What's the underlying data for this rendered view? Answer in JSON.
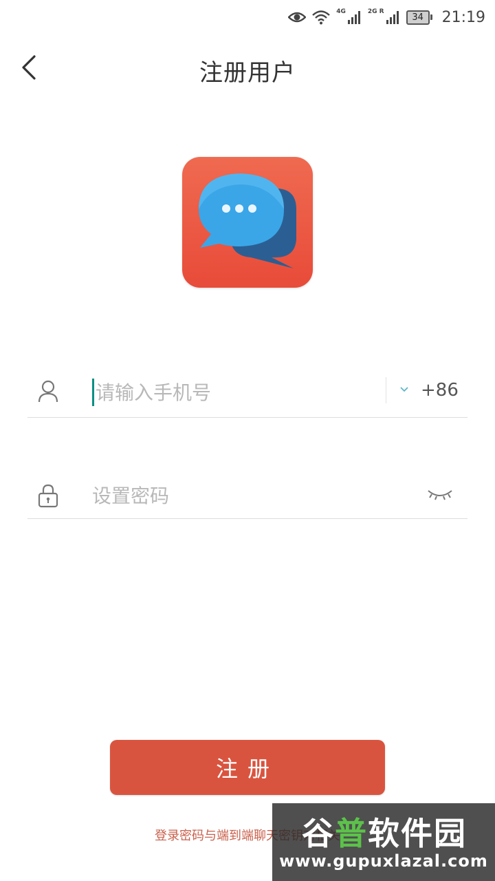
{
  "status_bar": {
    "time": "21:19",
    "battery": "34",
    "net_tag_1": "4G",
    "net_tag_2": "2G R",
    "icons": [
      "eye-icon",
      "wifi-icon",
      "signal-icon",
      "signal-icon",
      "battery-icon"
    ]
  },
  "header": {
    "title": "注册用户",
    "back_icon": "chevron-left-icon"
  },
  "logo": {
    "icon": "chat-bubbles-icon",
    "colors": {
      "background": "#e84b39",
      "bubble_front": "#3aa6e8",
      "bubble_back": "#2b5f93"
    }
  },
  "form": {
    "phone": {
      "placeholder": "请输入手机号",
      "value": "",
      "country_code": "+86",
      "icon": "user-icon",
      "dropdown_icon": "chevron-down-icon"
    },
    "password": {
      "placeholder": "设置密码",
      "value": "",
      "icon": "lock-icon",
      "toggle_icon": "eye-closed-icon"
    }
  },
  "register_button": {
    "label": "注册"
  },
  "notice": "登录密码与端到端聊天密钥对相关",
  "watermark": {
    "title_white_1": "谷",
    "title_accent": "普",
    "title_white_2": "软件园",
    "url": "www.gupuxlazal.com"
  },
  "colors": {
    "accent": "#d9543f",
    "cursor": "#0b8f84",
    "notice": "#c9604c"
  }
}
